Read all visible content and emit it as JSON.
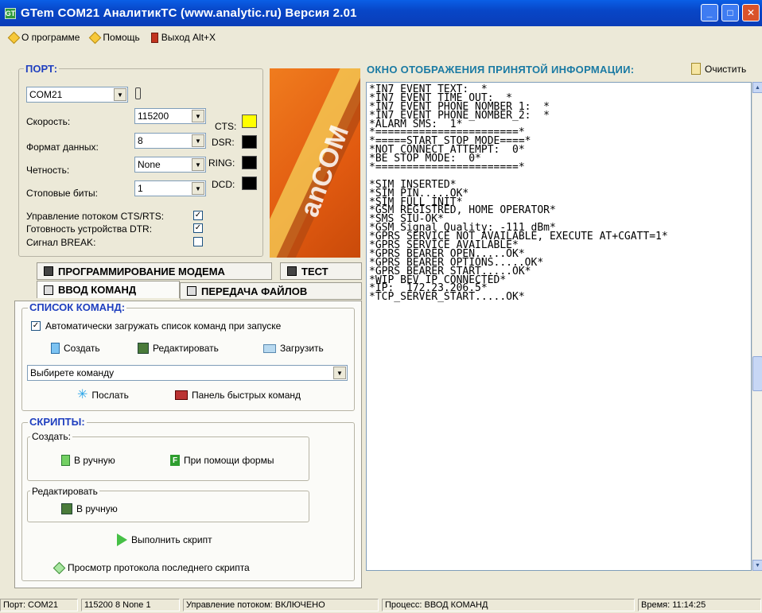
{
  "window": {
    "app_icon": "GT",
    "title": "GTem   COM21   АналитикТС (www.analytic.ru)   Версия 2.01"
  },
  "menu": {
    "about": "О программе",
    "help": "Помощь",
    "exit": "Выход Alt+X"
  },
  "port": {
    "legend": "ПОРТ:",
    "port_value": "COM21",
    "speed_label": "Скорость:",
    "speed_value": "115200",
    "format_label": "Формат данных:",
    "format_value": "8",
    "parity_label": "Четность:",
    "parity_value": "None",
    "stopbits_label": "Стоповые биты:",
    "stopbits_value": "1",
    "cts_label": "CTS:",
    "dsr_label": "DSR:",
    "ring_label": "RING:",
    "dcd_label": "DCD:",
    "flow_label": "Управление потоком CTS/RTS:",
    "dtr_label": "Готовность устройства DTR:",
    "break_label": "Сигнал BREAK:",
    "indicator_colors": {
      "on": "#ffff00",
      "off": "#000000"
    }
  },
  "logo": {
    "brand": "anCOM"
  },
  "tabs": {
    "modem": "ПРОГРАММИРОВАНИЕ МОДЕМА",
    "test": "ТЕСТ",
    "commands": "ВВОД КОМАНД",
    "files": "ПЕРЕДАЧА ФАЙЛОВ"
  },
  "commands": {
    "legend": "СПИСОК КОМАНД:",
    "autoload": "Автоматически загружать список команд при запуске",
    "create": "Создать",
    "edit": "Редактировать",
    "load": "Загрузить",
    "select_placeholder": "Выбирете команду",
    "send": "Послать",
    "quick_panel": "Панель быстрых команд"
  },
  "scripts": {
    "legend": "СКРИПТЫ:",
    "create_caption": "Создать:",
    "manual": "В ручную",
    "form": "При помощи формы",
    "edit_caption": "Редактировать",
    "edit_manual": "В ручную",
    "run": "Выполнить скрипт",
    "view_log": "Просмотр протокола последнего скрипта"
  },
  "output": {
    "title": "ОКНО ОТОБРАЖЕНИЯ ПРИНЯТОЙ ИНФОРМАЦИИ:",
    "clear": "Очистить",
    "lines": [
      "*IN7 EVENT TEXT:  *",
      "*IN7 EVENT TIME OUT:  *",
      "*IN7 EVENT PHONE NOMBER 1:  *",
      "*IN7 EVENT PHONE_NOMBER_2:  *",
      "*ALARM SMS:  1*",
      "*=======================*",
      "*=====START STOP MODE====*",
      "*NOT CONNECT ATTEMPT:  0*",
      "*BE STOP MODE:  0*",
      "*=======================*",
      "",
      "*SIM INSERTED*",
      "*SIM PIN.....OK*",
      "*SIM FULL INIT*",
      "*GSM REGISTRED, HOME OPERATOR*",
      "*SMS SIU-OK*",
      "*GSM Signal Quality: -111 dBm*",
      "*GPRS SERVICE NOT AVAILABLE, EXECUTE AT+CGATT=1*",
      "*GPRS SERVICE AVAILABLE*",
      "*GPRS BEARER OPEN.....OK*",
      "*GPRS BEARER OPTIONS.....OK*",
      "*GPRS BEARER START.....OK*",
      "*WIP BEV IP CONNECTED*",
      "*IP:  172.23.206.5*",
      "*TCP_SERVER_START.....OK*"
    ]
  },
  "status": {
    "port": "Порт: COM21",
    "params": "115200 8 None 1",
    "flow": "Управление потоком: ВКЛЮЧЕНО",
    "process": "Процесс: ВВОД КОМАНД",
    "time": "Время: 11:14:25"
  }
}
